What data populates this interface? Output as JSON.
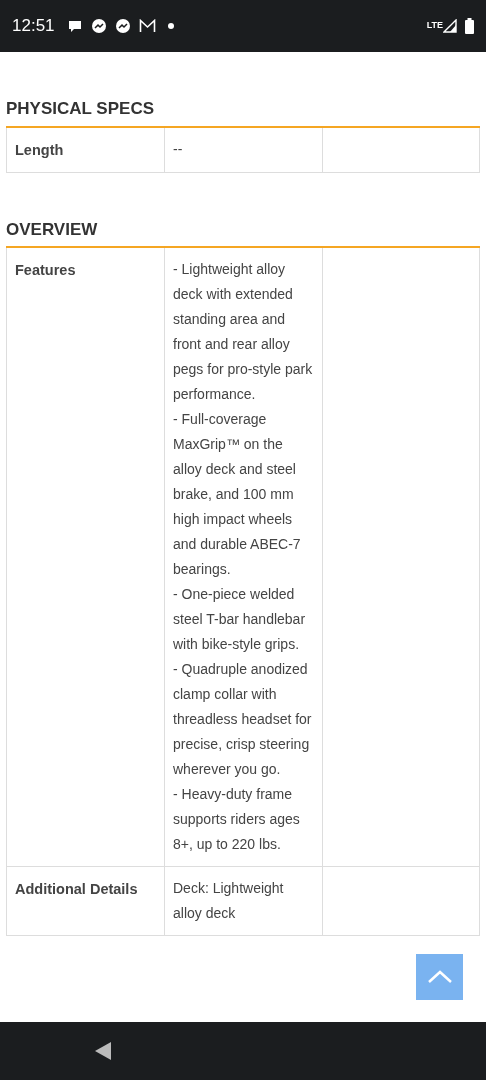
{
  "status_bar": {
    "time": "12:51",
    "network": "LTE"
  },
  "sections": [
    {
      "title": "PHYSICAL SPECS",
      "rows": [
        {
          "label": "Length",
          "value": [
            "--"
          ]
        }
      ]
    },
    {
      "title": "OVERVIEW",
      "rows": [
        {
          "label": "Features",
          "value": [
            "- Lightweight alloy deck with extended standing area and front and rear alloy pegs for pro-style park performance.",
            "- Full-coverage MaxGrip™ on the alloy deck and steel brake, and 100 mm high impact wheels and durable ABEC-7 bearings.",
            "- One-piece welded steel T-bar handlebar with bike-style grips.",
            "- Quadruple anodized clamp collar with threadless headset for precise, crisp steering wherever you go.",
            "- Heavy-duty frame supports riders ages 8+, up to 220 lbs."
          ]
        },
        {
          "label": "Additional Details",
          "value": [
            "Deck: Lightweight alloy deck"
          ]
        }
      ]
    }
  ]
}
